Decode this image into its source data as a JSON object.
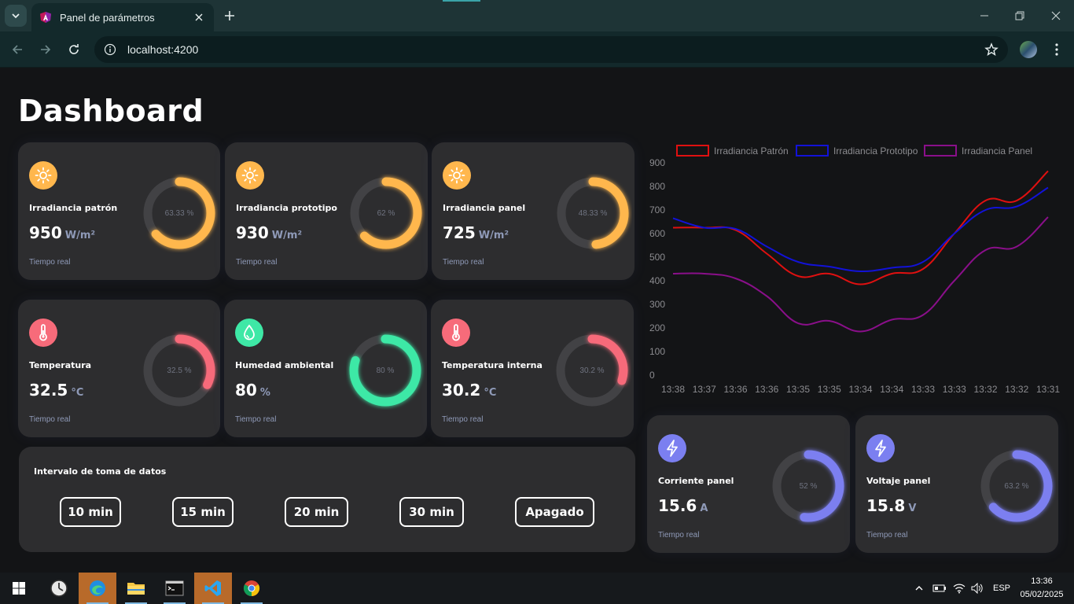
{
  "browser": {
    "tab_title": "Panel de parámetros",
    "url": "localhost:4200"
  },
  "page": {
    "title": "Dashboard"
  },
  "cards": [
    {
      "id": "irr-patron",
      "label": "Irradiancia patrón",
      "value": "950",
      "unit": "W/m²",
      "sub": "Tiempo real",
      "percent_label": "63.33 %",
      "percent": 63.33,
      "color": "#ffb74d",
      "icon": "sun-icon"
    },
    {
      "id": "irr-prototipo",
      "label": "Irradiancia prototipo",
      "value": "930",
      "unit": "W/m²",
      "sub": "Tiempo real",
      "percent_label": "62 %",
      "percent": 62,
      "color": "#ffb74d",
      "icon": "sun-icon"
    },
    {
      "id": "irr-panel",
      "label": "Irradiancia panel",
      "value": "725",
      "unit": "W/m²",
      "sub": "Tiempo real",
      "percent_label": "48.33 %",
      "percent": 48.33,
      "color": "#ffb74d",
      "icon": "sun-icon"
    },
    {
      "id": "temp",
      "label": "Temperatura",
      "value": "32.5",
      "unit": "°C",
      "sub": "Tiempo real",
      "percent_label": "32.5 %",
      "percent": 32.5,
      "color": "#f76b7a",
      "icon": "thermometer-icon"
    },
    {
      "id": "humedad",
      "label": "Humedad ambiental",
      "value": "80",
      "unit": "%",
      "sub": "Tiempo real",
      "percent_label": "80 %",
      "percent": 80,
      "color": "#3ee8a6",
      "icon": "water-drop-icon"
    },
    {
      "id": "temp-int",
      "label": "Temperatura interna",
      "value": "30.2",
      "unit": "°C",
      "sub": "Tiempo real",
      "percent_label": "30.2 %",
      "percent": 30.2,
      "color": "#f76b7a",
      "icon": "thermometer-icon"
    },
    {
      "id": "corriente",
      "label": "Corriente panel",
      "value": "15.6",
      "unit": "A",
      "sub": "Tiempo real",
      "percent_label": "52 %",
      "percent": 52,
      "color": "#7b7ff0",
      "icon": "lightning-icon"
    },
    {
      "id": "voltaje",
      "label": "Voltaje panel",
      "value": "15.8",
      "unit": "V",
      "sub": "Tiempo real",
      "percent_label": "63.2 %",
      "percent": 63.2,
      "color": "#7b7ff0",
      "icon": "lightning-icon"
    }
  ],
  "interval": {
    "title": "Intervalo de toma de datos",
    "buttons": [
      "10 min",
      "15 min",
      "20 min",
      "30 min",
      "Apagado"
    ]
  },
  "chart_data": {
    "type": "line",
    "x": [
      "13:38",
      "13:37",
      "13:36",
      "13:36",
      "13:35",
      "13:35",
      "13:34",
      "13:34",
      "13:33",
      "13:33",
      "13:32",
      "13:32",
      "13:31"
    ],
    "ylim": [
      0,
      900
    ],
    "yticks": [
      0,
      100,
      200,
      300,
      400,
      500,
      600,
      700,
      800,
      900
    ],
    "legend_position": "top",
    "series": [
      {
        "name": "Irradiancia Patrón",
        "color": "#e01010",
        "values": [
          625,
          625,
          615,
          515,
          420,
          430,
          385,
          430,
          450,
          600,
          740,
          740,
          865
        ]
      },
      {
        "name": "Irradiancia Prototipo",
        "color": "#1212d8",
        "values": [
          665,
          625,
          620,
          545,
          480,
          460,
          440,
          455,
          480,
          600,
          700,
          715,
          795
        ]
      },
      {
        "name": "Irradiancia Panel",
        "color": "#8a0f8a",
        "values": [
          430,
          430,
          410,
          335,
          220,
          230,
          185,
          235,
          255,
          400,
          530,
          545,
          670
        ]
      }
    ]
  },
  "taskbar": {
    "language": "ESP",
    "time": "13:36",
    "date": "05/02/2025"
  }
}
